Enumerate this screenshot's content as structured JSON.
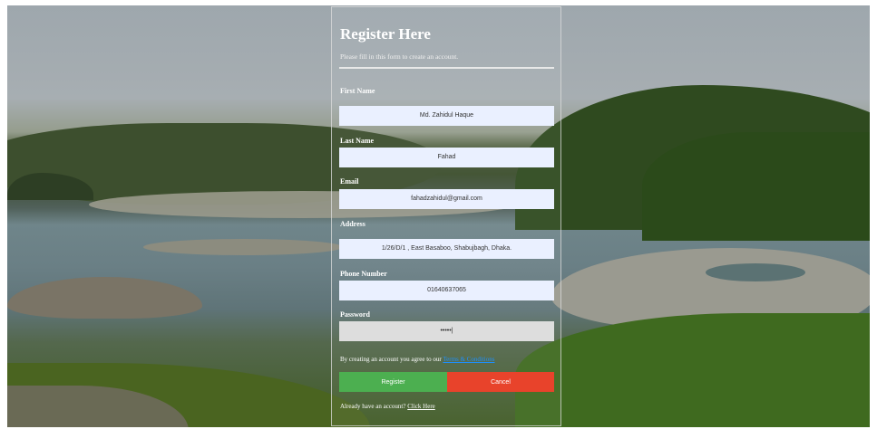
{
  "form": {
    "title": "Register Here",
    "subtitle": "Please fill in this form to create an account.",
    "fields": [
      {
        "label": "First Name",
        "value": "Md. Zahidul Haque"
      },
      {
        "label": "Last Name",
        "value": "Fahad"
      },
      {
        "label": "Email",
        "value": "fahadzahidul@gmail.com"
      },
      {
        "label": "Address",
        "value": "1/26/D/1 , East Basaboo, Shabujbagh, Dhaka."
      },
      {
        "label": "Phone Number",
        "value": "01640637065"
      },
      {
        "label": "Password",
        "value": "•••••|"
      }
    ],
    "agree_text": "By creating an account you agree to our ",
    "agree_link": "Terms & Conditions",
    "register_label": "Register",
    "cancel_label": "Cancel",
    "signin_text": "Already have an account? ",
    "signin_link": "Click Here"
  },
  "colors": {
    "register": "#4caf50",
    "cancel": "#e8432b",
    "input_bg": "#eaf0ff",
    "password_bg": "#dddddd",
    "link": "#1e90ff"
  }
}
